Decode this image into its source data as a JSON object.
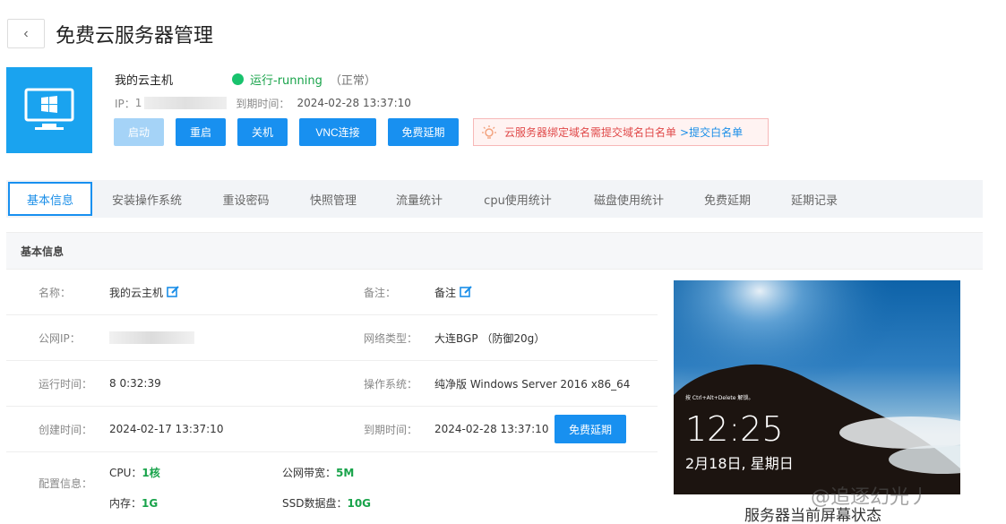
{
  "header": {
    "back_label": "‹",
    "title": "免费云服务器管理"
  },
  "server": {
    "name": "我的云主机",
    "status": "运行-running",
    "status_note": "（正常）",
    "ip_label": "IP：",
    "ip_prefix": "1",
    "expire_label": "到期时间：",
    "expire_value": "2024-02-28 13:37:10"
  },
  "actions": {
    "start": "启动",
    "restart": "重启",
    "shutdown": "关机",
    "vnc": "VNC连接",
    "extend": "免费延期"
  },
  "notice": {
    "text": "云服务器绑定域名需提交域名白名单",
    "link": ">提交白名单"
  },
  "tabs": [
    "基本信息",
    "安装操作系统",
    "重设密码",
    "快照管理",
    "流量统计",
    "cpu使用统计",
    "磁盘使用统计",
    "免费延期",
    "延期记录"
  ],
  "section_title": "基本信息",
  "details": {
    "name_label": "名称：",
    "name_value": "我的云主机",
    "remark_label": "备注：",
    "remark_value": "备注",
    "public_ip_label": "公网IP：",
    "network_label": "网络类型：",
    "network_value": "大连BGP （防御20g）",
    "uptime_label": "运行时间：",
    "uptime_value": "8 0:32:39",
    "os_label": "操作系统：",
    "os_value": "纯净版 Windows Server 2016 x86_64 (",
    "created_label": "创建时间：",
    "created_value": "2024-02-17 13:37:10",
    "expire_label": "到期时间：",
    "expire_value": "2024-02-28 13:37:10",
    "extend_button": "免费延期",
    "config_label": "配置信息：",
    "cpu_label": "CPU：",
    "cpu_value": "1核",
    "bandwidth_label": "公网带宽：",
    "bandwidth_value": "5M",
    "memory_label": "内存：",
    "memory_value": "1G",
    "disk_label": "SSD数据盘：",
    "disk_value": "10G"
  },
  "screen": {
    "hint": "按 Ctrl+Alt+Delete 解锁。",
    "time": "12:25",
    "date": "2月18日, 星期日",
    "caption": "服务器当前屏幕状态"
  },
  "watermark": "@追逐幻光丿",
  "colors": {
    "primary": "#1890f0",
    "success": "#18c26d",
    "server_icon_bg": "#1aa3ef",
    "notice_text": "#e04a4a"
  }
}
